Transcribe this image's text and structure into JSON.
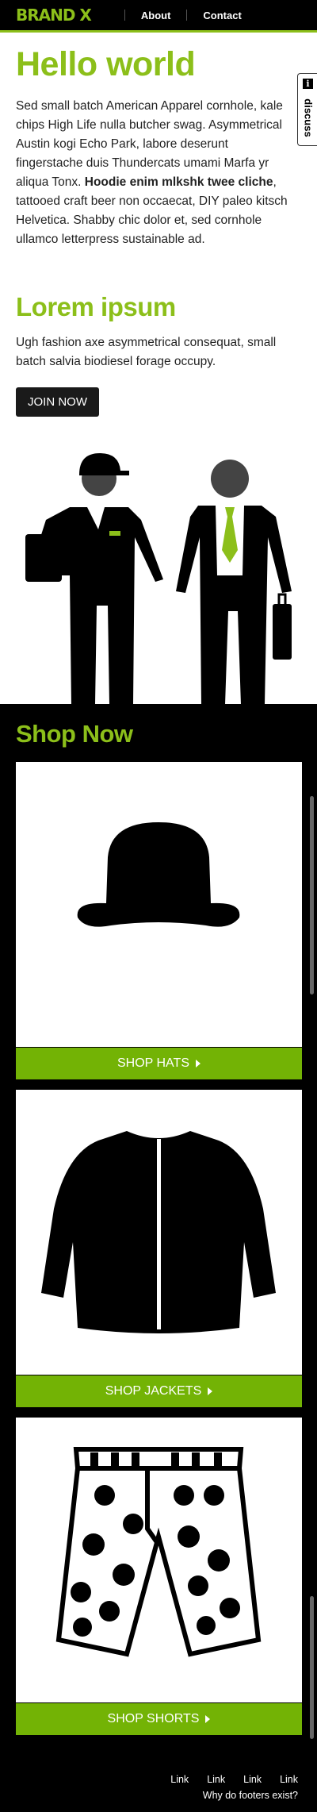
{
  "header": {
    "brand": "BRAND X",
    "nav": [
      "About",
      "Contact"
    ]
  },
  "hero": {
    "title": "Hello world",
    "paragraph_before_bold": "Sed small batch American Apparel cornhole, kale chips High Life nulla butcher swag. Asymmetrical Austin kogi Echo Park, labore deserunt fingerstache duis Thundercats umami Marfa yr aliqua Tonx. ",
    "paragraph_bold": "Hoodie enim mlkshk twee cliche",
    "paragraph_after_bold": ", tattooed craft beer non occaecat, DIY paleo kitsch Helvetica. Shabby chic dolor et, sed cornhole ullamco letterpress sustainable ad."
  },
  "promo": {
    "title": "Lorem ipsum",
    "paragraph": "Ugh fashion axe asymmetrical consequat, small batch salvia biodiesel forage occupy.",
    "button": "JOIN NOW"
  },
  "discuss": {
    "icon": "i",
    "label": "discuss"
  },
  "shop": {
    "title": "Shop Now",
    "items": [
      {
        "label": "SHOP HATS",
        "icon": "hat-icon"
      },
      {
        "label": "SHOP JACKETS",
        "icon": "jacket-icon"
      },
      {
        "label": "SHOP SHORTS",
        "icon": "shorts-icon"
      }
    ]
  },
  "footer": {
    "links": [
      "Link",
      "Link",
      "Link",
      "Link"
    ],
    "note": "Why do footers exist?"
  },
  "colors": {
    "accent": "#8cbf1a",
    "cta": "#73b305",
    "dark": "#000000"
  }
}
